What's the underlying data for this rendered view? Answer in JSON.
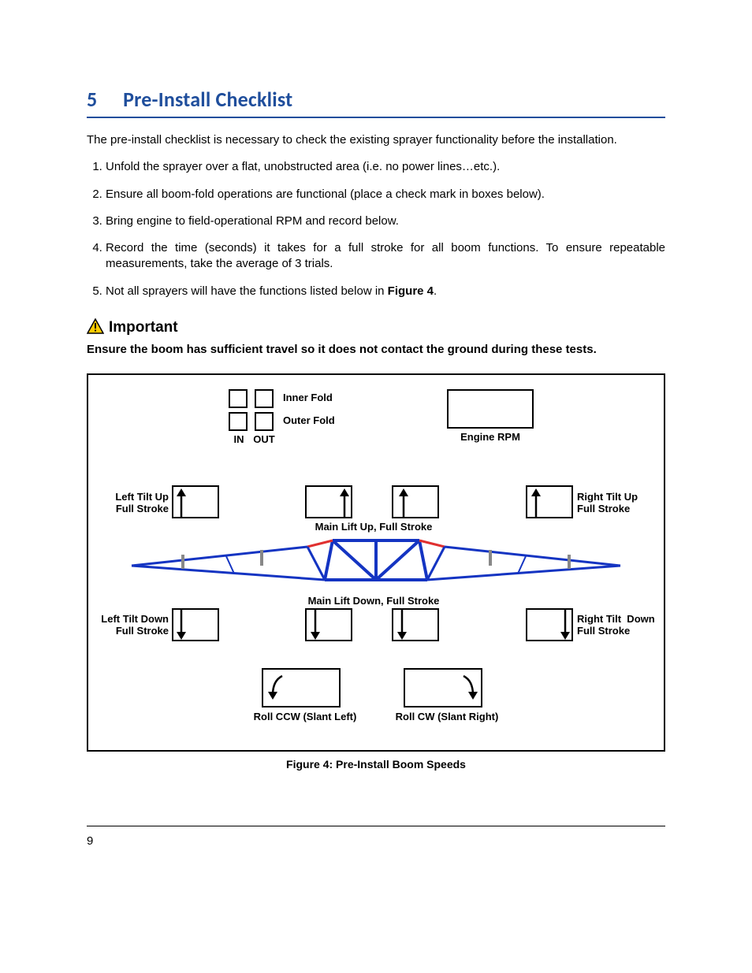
{
  "section": {
    "number": "5",
    "title": "Pre-Install Checklist"
  },
  "intro": "The pre-install checklist is necessary to check the existing sprayer functionality before the installation.",
  "steps": {
    "s1": "Unfold the sprayer over a flat, unobstructed area (i.e. no power lines…etc.).",
    "s2": "Ensure all boom-fold operations are functional (place a check mark in boxes below).",
    "s3": "Bring engine to field-operational RPM and record below.",
    "s4": "Record the time (seconds) it takes for a full stroke for all boom functions.  To ensure repeatable measurements, take the average of 3 trials.",
    "s5a": "Not all sprayers will have the functions listed below in ",
    "s5b": "Figure 4",
    "s5c": "."
  },
  "important": {
    "label": "Important",
    "text": "Ensure the boom has sufficient travel so it does not contact the ground during these tests."
  },
  "figure": {
    "inner_fold": "Inner Fold",
    "outer_fold": "Outer Fold",
    "in": "IN",
    "out": "OUT",
    "engine_rpm": "Engine RPM",
    "left_tilt_up": "Left Tilt Up\nFull Stroke",
    "right_tilt_up": "Right Tilt Up\nFull Stroke",
    "main_lift_up": "Main Lift Up, Full Stroke",
    "main_lift_down": "Main Lift Down, Full Stroke",
    "left_tilt_down": "Left Tilt Down\nFull Stroke",
    "right_tilt_down": "Right Tilt  Down\nFull Stroke",
    "roll_ccw": "Roll CCW (Slant Left)",
    "roll_cw": "Roll CW (Slant Right)",
    "caption": "Figure 4: Pre-Install Boom Speeds"
  },
  "page_number": "9"
}
